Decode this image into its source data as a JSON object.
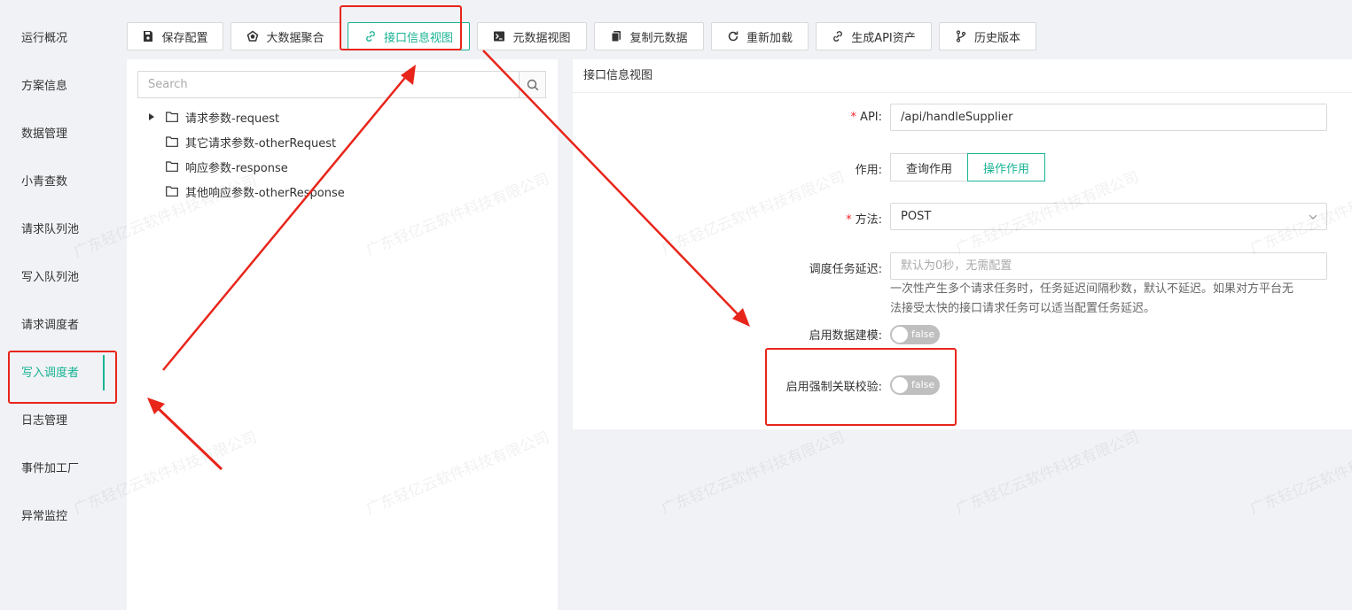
{
  "sidebar": {
    "items": [
      {
        "label": "运行概况"
      },
      {
        "label": "方案信息"
      },
      {
        "label": "数据管理"
      },
      {
        "label": "小青查数"
      },
      {
        "label": "请求队列池"
      },
      {
        "label": "写入队列池"
      },
      {
        "label": "请求调度者"
      },
      {
        "label": "写入调度者",
        "active": true
      },
      {
        "label": "日志管理"
      },
      {
        "label": "事件加工厂"
      },
      {
        "label": "异常监控"
      }
    ]
  },
  "toolbar": {
    "buttons": [
      {
        "label": "保存配置",
        "icon": "save-icon"
      },
      {
        "label": "大数据聚合",
        "icon": "pentagon-icon"
      },
      {
        "label": "接口信息视图",
        "icon": "link-icon",
        "active": true
      },
      {
        "label": "元数据视图",
        "icon": "terminal-icon"
      },
      {
        "label": "复制元数据",
        "icon": "copy-icon"
      },
      {
        "label": "重新加载",
        "icon": "reload-icon"
      },
      {
        "label": "生成API资产",
        "icon": "link-icon"
      },
      {
        "label": "历史版本",
        "icon": "branch-icon"
      }
    ]
  },
  "tree": {
    "search_placeholder": "Search",
    "nodes": [
      {
        "label": "请求参数-request",
        "expandable": true
      },
      {
        "label": "其它请求参数-otherRequest",
        "expandable": false
      },
      {
        "label": "响应参数-response",
        "expandable": false
      },
      {
        "label": "其他响应参数-otherResponse",
        "expandable": false
      }
    ]
  },
  "form": {
    "title": "接口信息视图",
    "api": {
      "label": "API:",
      "value": "/api/handleSupplier",
      "required": true
    },
    "usage": {
      "label": "作用:",
      "options": [
        "查询作用",
        "操作作用"
      ],
      "selected": "操作作用"
    },
    "method": {
      "label": "方法:",
      "value": "POST",
      "required": true
    },
    "delay": {
      "label": "调度任务延迟:",
      "placeholder": "默认为0秒，无需配置",
      "help_line1": "一次性产生多个请求任务时，任务延迟间隔秒数，默认不延迟。如果对方平台无",
      "help_line2": "法接受太快的接口请求任务可以适当配置任务延迟。"
    },
    "data_modeling": {
      "label": "启用数据建模:",
      "value": "false"
    },
    "force_validation": {
      "label": "启用强制关联校验:",
      "value": "false"
    }
  },
  "watermark": "广东轻亿云软件科技有限公司",
  "colors": {
    "accent": "#1ab394",
    "annotation": "#e8251b",
    "required": "#f5222d"
  }
}
